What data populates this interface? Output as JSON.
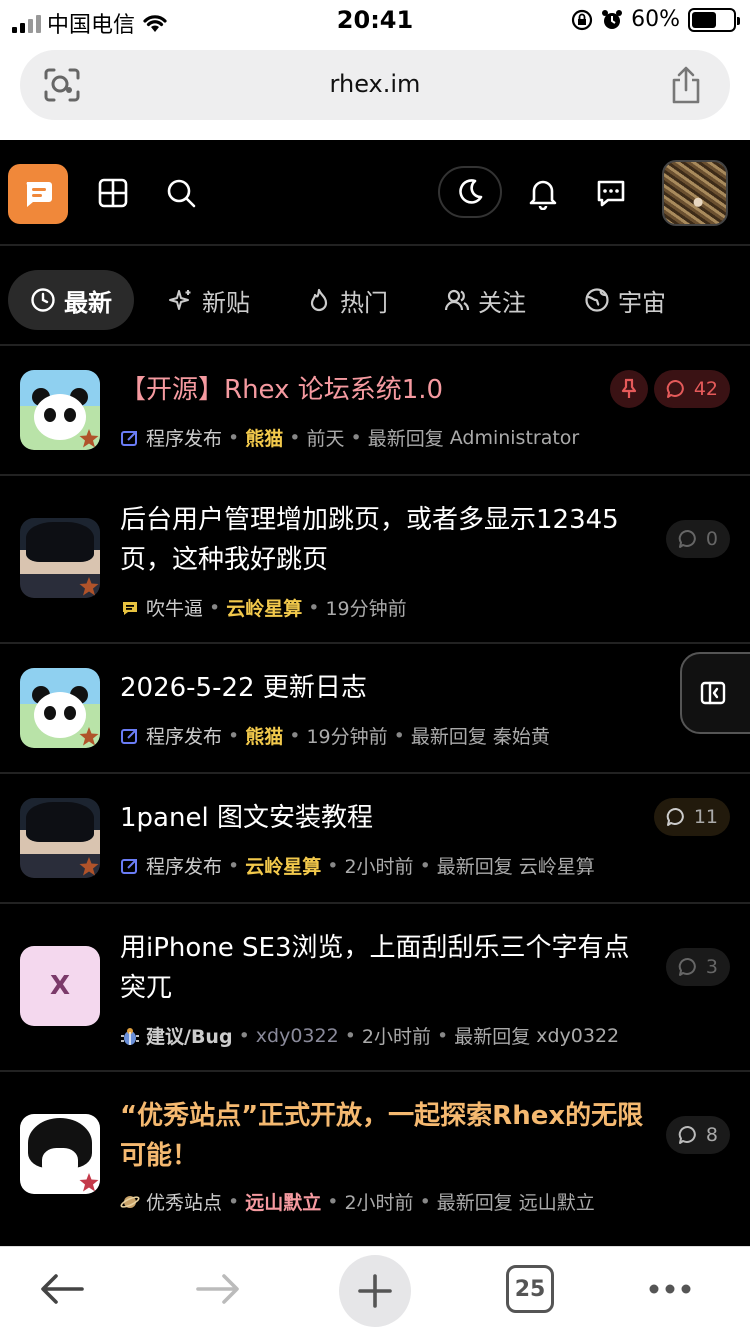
{
  "status_bar": {
    "carrier": "中国电信",
    "time": "20:41",
    "battery": "60%",
    "battery_level": 0.6
  },
  "browser": {
    "url": "rhex.im",
    "tab_count": "25"
  },
  "header": {
    "logo_icon": "chat-logo-icon",
    "icons": [
      "grid-icon",
      "search-icon",
      "moon-icon",
      "bell-icon",
      "message-icon"
    ]
  },
  "tabs": [
    {
      "label": "最新",
      "icon": "clock-icon",
      "active": true
    },
    {
      "label": "新贴",
      "icon": "sparkle-icon"
    },
    {
      "label": "热门",
      "icon": "flame-icon"
    },
    {
      "label": "关注",
      "icon": "users-icon"
    },
    {
      "label": "宇宙",
      "icon": "globe-icon"
    }
  ],
  "posts": [
    {
      "title": "【开源】Rhex 论坛系统1.0",
      "category": "程序发布",
      "author": "熊猫",
      "time": "前天",
      "latest_reply_label": "最新回复",
      "latest_reply_user": "Administrator",
      "replies": "42",
      "pinned": true
    },
    {
      "title": "后台用户管理增加跳页，或者多显示12345页，这种我好跳页",
      "category": "吹牛逼",
      "author": "云岭星算",
      "time": "19分钟前",
      "replies": "0"
    },
    {
      "title": "2026-5-22 更新日志",
      "category": "程序发布",
      "author": "熊猫",
      "time": "19分钟前",
      "latest_reply_label": "最新回复",
      "latest_reply_user": "秦始黄"
    },
    {
      "title": "1panel 图文安装教程",
      "category": "程序发布",
      "author": "云岭星算",
      "time": "2小时前",
      "latest_reply_label": "最新回复",
      "latest_reply_user": "云岭星算",
      "replies": "11"
    },
    {
      "title": "用iPhone SE3浏览，上面刮刮乐三个字有点突兀",
      "avatar_letter": "X",
      "category": "建议/Bug",
      "author": "xdy0322",
      "time": "2小时前",
      "latest_reply_label": "最新回复",
      "latest_reply_user": "xdy0322",
      "replies": "3"
    },
    {
      "title": "“优秀站点”正式开放，一起探索Rhex的无限可能！",
      "category": "优秀站点",
      "author": "远山默立",
      "time": "2小时前",
      "latest_reply_label": "最新回复",
      "latest_reply_user": "远山默立",
      "replies": "8"
    }
  ],
  "colors": {
    "accent": "#f0883a",
    "pinned_title": "#f59aa0",
    "featured_title": "#f5b970",
    "author_highlight": "#f2c94c"
  }
}
